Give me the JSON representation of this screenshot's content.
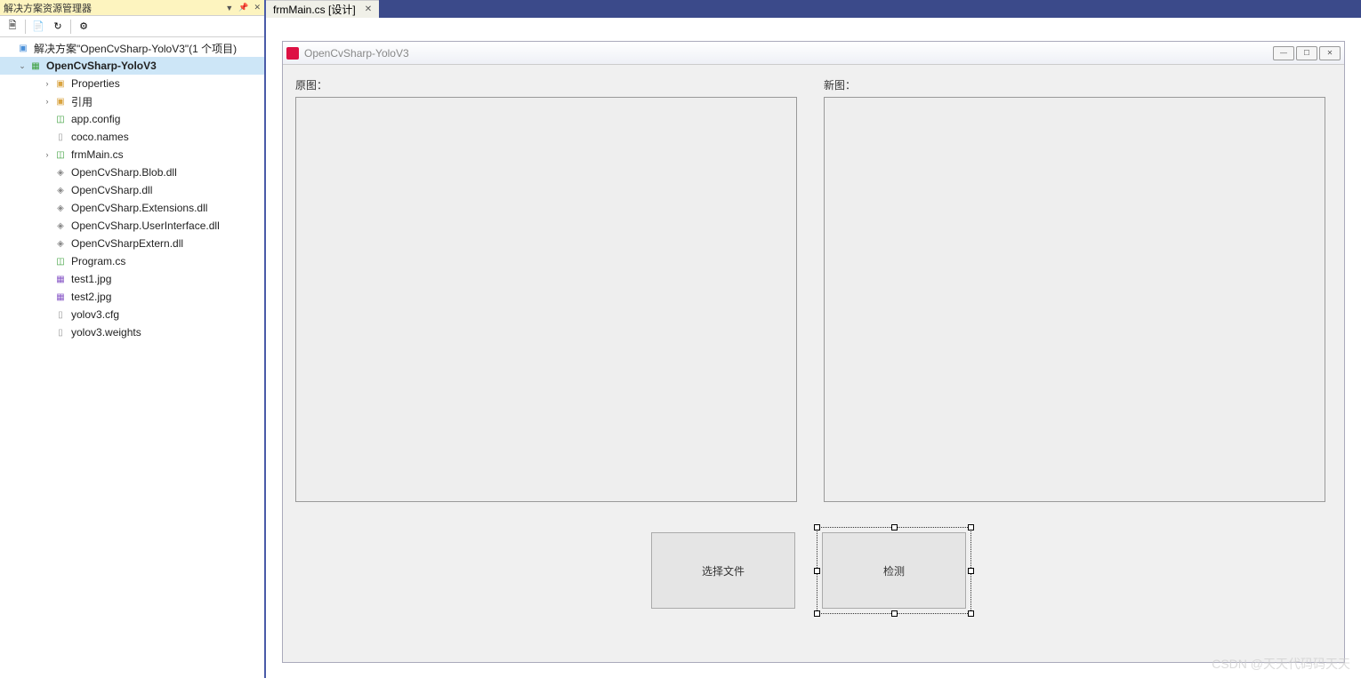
{
  "solutionExplorer": {
    "title": "解决方案资源管理器",
    "solution": "解决方案\"OpenCvSharp-YoloV3\"(1 个项目)",
    "project": "OpenCvSharp-YoloV3",
    "items": [
      {
        "label": "Properties",
        "icon": "folder",
        "expandable": true
      },
      {
        "label": "引用",
        "icon": "folder",
        "expandable": true
      },
      {
        "label": "app.config",
        "icon": "cs",
        "expandable": false
      },
      {
        "label": "coco.names",
        "icon": "file",
        "expandable": false
      },
      {
        "label": "frmMain.cs",
        "icon": "cs",
        "expandable": true
      },
      {
        "label": "OpenCvSharp.Blob.dll",
        "icon": "dll",
        "expandable": false
      },
      {
        "label": "OpenCvSharp.dll",
        "icon": "dll",
        "expandable": false
      },
      {
        "label": "OpenCvSharp.Extensions.dll",
        "icon": "dll",
        "expandable": false
      },
      {
        "label": "OpenCvSharp.UserInterface.dll",
        "icon": "dll",
        "expandable": false
      },
      {
        "label": "OpenCvSharpExtern.dll",
        "icon": "dll",
        "expandable": false
      },
      {
        "label": "Program.cs",
        "icon": "cs",
        "expandable": false
      },
      {
        "label": "test1.jpg",
        "icon": "img",
        "expandable": false
      },
      {
        "label": "test2.jpg",
        "icon": "img",
        "expandable": false
      },
      {
        "label": "yolov3.cfg",
        "icon": "file",
        "expandable": false
      },
      {
        "label": "yolov3.weights",
        "icon": "file",
        "expandable": false
      }
    ]
  },
  "tab": {
    "label": "frmMain.cs [设计]"
  },
  "form": {
    "title": "OpenCvSharp-YoloV3",
    "label1": "原图：",
    "label2": "新图：",
    "button1": "选择文件",
    "button2": "检测"
  },
  "watermark": "CSDN @天天代码码天天"
}
